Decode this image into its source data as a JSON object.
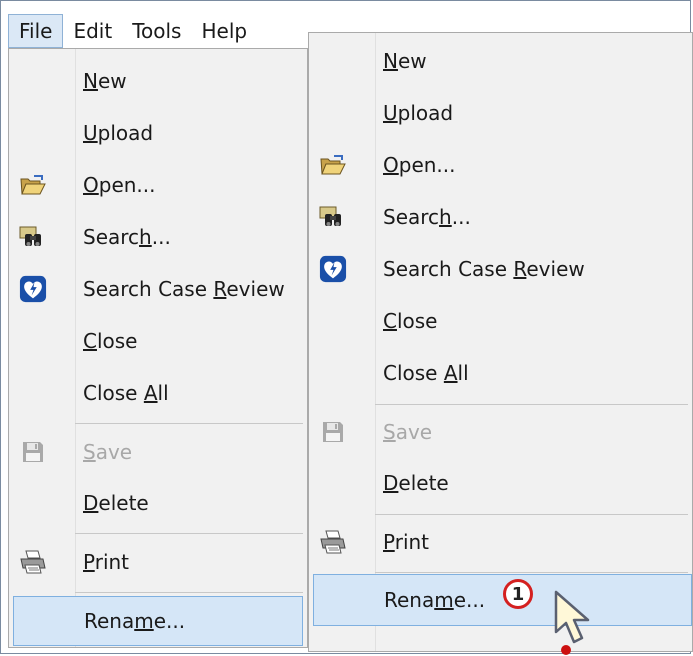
{
  "menubar": {
    "items": [
      "File",
      "Edit",
      "Tools",
      "Help"
    ]
  },
  "menu": {
    "items": [
      {
        "label_pre": "",
        "label_u": "N",
        "label_post": "ew",
        "icon": ""
      },
      {
        "label_pre": "",
        "label_u": "U",
        "label_post": "pload",
        "icon": ""
      },
      {
        "label_pre": "",
        "label_u": "O",
        "label_post": "pen...",
        "icon": "open-folder-icon"
      },
      {
        "label_pre": "Searc",
        "label_u": "h",
        "label_post": "...",
        "icon": "binoculars-icon"
      },
      {
        "label_pre": "Search Case ",
        "label_u": "R",
        "label_post": "eview",
        "icon": "heart-shield-icon"
      },
      {
        "label_pre": "",
        "label_u": "C",
        "label_post": "lose",
        "icon": ""
      },
      {
        "label_pre": "Close ",
        "label_u": "A",
        "label_post": "ll",
        "icon": ""
      },
      {
        "label_pre": "",
        "label_u": "S",
        "label_post": "ave",
        "icon": "floppy-disk-icon",
        "disabled": true
      },
      {
        "label_pre": "",
        "label_u": "D",
        "label_post": "elete",
        "icon": ""
      },
      {
        "label_pre": "",
        "label_u": "P",
        "label_post": "rint",
        "icon": "printer-icon"
      },
      {
        "label_pre": "Rena",
        "label_u": "m",
        "label_post": "e...",
        "icon": ""
      }
    ]
  },
  "callout": {
    "number": "1"
  },
  "colors": {
    "menu_bg": "#f1f1f1",
    "hover_bg": "#d5e6f7",
    "hover_border": "#7fb0e0",
    "callout_ring": "#d42020",
    "shield_blue": "#1a4fa8"
  }
}
